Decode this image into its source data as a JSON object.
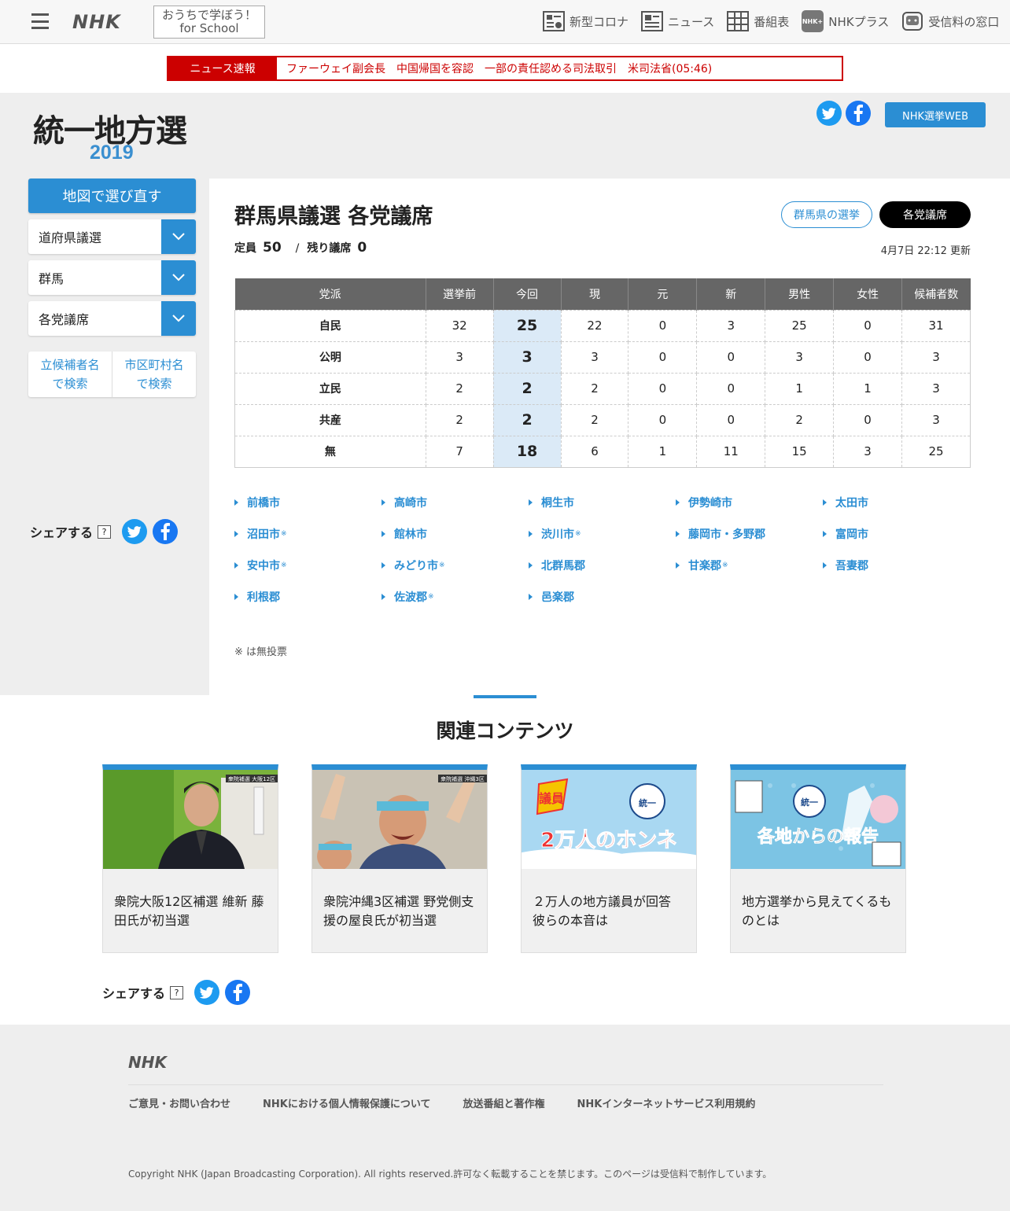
{
  "header": {
    "logo": "NHK",
    "school_line1": "おうちで学ぼう！",
    "school_line2": "for School",
    "nav": [
      {
        "label": "新型コロナ",
        "icon": "corona-news-icon"
      },
      {
        "label": "ニュース",
        "icon": "newspaper-icon"
      },
      {
        "label": "番組表",
        "icon": "program-grid-icon"
      },
      {
        "label": "NHKプラス",
        "icon": "nhk-plus-icon"
      },
      {
        "label": "受信料の窓口",
        "icon": "receiver-fee-icon"
      }
    ]
  },
  "breaking": {
    "label": "ニュース速報",
    "text": "ファーウェイ副会長　中国帰国を容認　一部の責任認める司法取引　米司法省(05:46)"
  },
  "brand": {
    "title": "統一地方選",
    "year": "2019",
    "web_button": "NHK選挙WEB"
  },
  "sidebar": {
    "redo_button": "地図で選び直す",
    "selects": [
      "道府県議選",
      "群馬",
      "各党議席"
    ],
    "search_candidate": [
      "立候補者名",
      "で検索"
    ],
    "search_city": [
      "市区町村名",
      "で検索"
    ],
    "share_label": "シェアする",
    "help": "?"
  },
  "main": {
    "title": "群馬県議選 各党議席",
    "btn_prefecture": "群馬県の選挙",
    "btn_party": "各党議席",
    "quota_label": "定員",
    "quota": "50",
    "separator": "/",
    "remaining_label": "残り議席",
    "remaining": "0",
    "updated": "4月7日 22:12 更新",
    "table": {
      "headers": [
        "党派",
        "選挙前",
        "今回",
        "現",
        "元",
        "新",
        "男性",
        "女性",
        "候補者数"
      ],
      "rows": [
        [
          "自民",
          "32",
          "25",
          "22",
          "0",
          "3",
          "25",
          "0",
          "31"
        ],
        [
          "公明",
          "3",
          "3",
          "3",
          "0",
          "0",
          "3",
          "0",
          "3"
        ],
        [
          "立民",
          "2",
          "2",
          "2",
          "0",
          "0",
          "1",
          "1",
          "3"
        ],
        [
          "共産",
          "2",
          "2",
          "2",
          "0",
          "0",
          "2",
          "0",
          "3"
        ],
        [
          "無",
          "7",
          "18",
          "6",
          "1",
          "11",
          "15",
          "3",
          "25"
        ]
      ]
    },
    "cities": [
      {
        "name": "前橋市",
        "mark": ""
      },
      {
        "name": "高崎市",
        "mark": ""
      },
      {
        "name": "桐生市",
        "mark": ""
      },
      {
        "name": "伊勢崎市",
        "mark": ""
      },
      {
        "name": "太田市",
        "mark": ""
      },
      {
        "name": "沼田市",
        "mark": "※"
      },
      {
        "name": "館林市",
        "mark": ""
      },
      {
        "name": "渋川市",
        "mark": "※"
      },
      {
        "name": "藤岡市・多野郡",
        "mark": ""
      },
      {
        "name": "富岡市",
        "mark": ""
      },
      {
        "name": "安中市",
        "mark": "※"
      },
      {
        "name": "みどり市",
        "mark": "※"
      },
      {
        "name": "北群馬郡",
        "mark": ""
      },
      {
        "name": "甘楽郡",
        "mark": "※"
      },
      {
        "name": "吾妻郡",
        "mark": ""
      },
      {
        "name": "利根郡",
        "mark": ""
      },
      {
        "name": "佐波郡",
        "mark": "※"
      },
      {
        "name": "邑楽郡",
        "mark": ""
      }
    ],
    "note": "※ は無投票"
  },
  "related": {
    "title": "関連コンテンツ",
    "cards": [
      {
        "text": "衆院大阪12区補選 維新 藤田氏が初当選",
        "caption": "衆院補選 大阪12区",
        "image": "photo-candidate-speech"
      },
      {
        "text": "衆院沖縄3区補選 野党側支援の屋良氏が初当選",
        "caption": "衆院補選 沖縄3区",
        "image": "photo-cheering-crowd"
      },
      {
        "text": "２万人の地方議員が回答 彼らの本音は",
        "caption": "2万人のホンネ",
        "badge": "議員",
        "image": "banner-honne"
      },
      {
        "text": "地方選挙から見えてくるものとは",
        "caption": "各地からの報告",
        "image": "banner-reports"
      }
    ],
    "share_label": "シェアする",
    "help": "?"
  },
  "footer": {
    "logo": "NHK",
    "links": [
      "ご意見・お問い合わせ",
      "NHKにおける個人情報保護について",
      "放送番組と著作権",
      "NHKインターネットサービス利用規約"
    ],
    "copyright": "Copyright NHK (Japan Broadcasting Corporation). All rights reserved.許可なく転載することを禁じます。このページは受信料で制作しています。"
  },
  "colors": {
    "accent": "#2b8ed3",
    "breaking": "#cc0000",
    "highlight_cell": "#dbeaf7",
    "twitter": "#1d9bf0",
    "facebook": "#1877f2"
  }
}
